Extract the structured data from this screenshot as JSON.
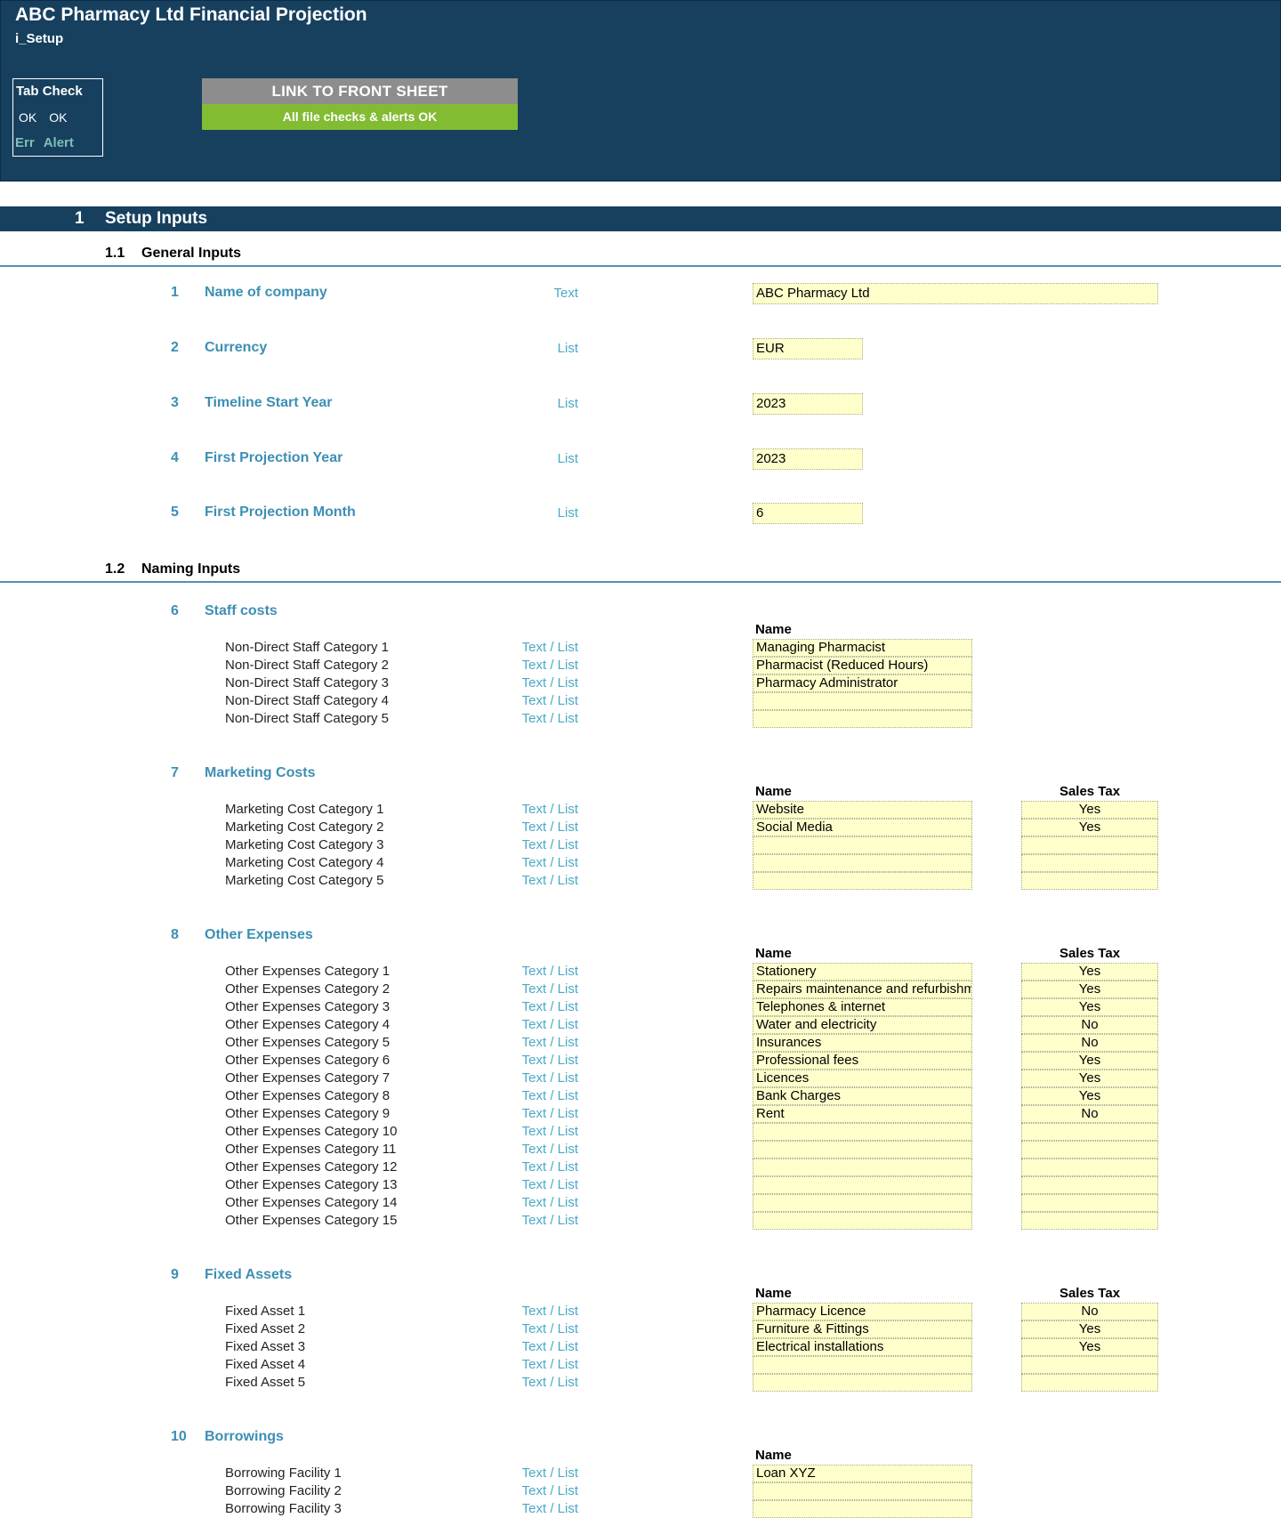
{
  "header": {
    "title": "ABC Pharmacy Ltd Financial Projection",
    "sheet_name": "i_Setup",
    "tab_check": {
      "title": "Tab Check",
      "row1": [
        "OK",
        "OK"
      ],
      "row2": [
        "Err",
        "Alert"
      ]
    },
    "link_button": "LINK TO FRONT SHEET",
    "check_status": "All file checks & alerts OK"
  },
  "section": {
    "number": "1",
    "title": "Setup Inputs"
  },
  "general": {
    "number": "1.1",
    "title": "General Inputs",
    "items": [
      {
        "num": "1",
        "label": "Name of company",
        "type": "Text",
        "value": "ABC Pharmacy Ltd"
      },
      {
        "num": "2",
        "label": "Currency",
        "type": "List",
        "value": "EUR"
      },
      {
        "num": "3",
        "label": "Timeline Start Year",
        "type": "List",
        "value": "2023"
      },
      {
        "num": "4",
        "label": "First Projection Year",
        "type": "List",
        "value": "2023"
      },
      {
        "num": "5",
        "label": "First Projection Month",
        "type": "List",
        "value": "6"
      }
    ]
  },
  "naming": {
    "number": "1.2",
    "title": "Naming Inputs",
    "col_name": "Name",
    "col_tax": "Sales Tax",
    "row_type": "Text / List",
    "groups": [
      {
        "num": "6",
        "title": "Staff costs",
        "has_tax": false,
        "rows": [
          {
            "label": "Non-Direct Staff Category 1",
            "name": "Managing Pharmacist"
          },
          {
            "label": "Non-Direct Staff Category 2",
            "name": "Pharmacist (Reduced Hours)"
          },
          {
            "label": "Non-Direct Staff Category 3",
            "name": "Pharmacy Administrator"
          },
          {
            "label": "Non-Direct Staff Category 4",
            "name": ""
          },
          {
            "label": "Non-Direct Staff Category 5",
            "name": ""
          }
        ]
      },
      {
        "num": "7",
        "title": "Marketing Costs",
        "has_tax": true,
        "rows": [
          {
            "label": "Marketing Cost Category 1",
            "name": "Website",
            "tax": "Yes"
          },
          {
            "label": "Marketing Cost Category 2",
            "name": "Social Media",
            "tax": "Yes"
          },
          {
            "label": "Marketing Cost Category 3",
            "name": "",
            "tax": ""
          },
          {
            "label": "Marketing Cost Category 4",
            "name": "",
            "tax": ""
          },
          {
            "label": "Marketing Cost Category 5",
            "name": "",
            "tax": ""
          }
        ]
      },
      {
        "num": "8",
        "title": "Other Expenses",
        "has_tax": true,
        "rows": [
          {
            "label": "Other Expenses Category 1",
            "name": "Stationery",
            "tax": "Yes"
          },
          {
            "label": "Other Expenses Category 2",
            "name": "Repairs maintenance and refurbishme",
            "tax": "Yes"
          },
          {
            "label": "Other Expenses Category 3",
            "name": "Telephones & internet",
            "tax": "Yes"
          },
          {
            "label": "Other Expenses Category 4",
            "name": "Water and electricity",
            "tax": "No"
          },
          {
            "label": "Other Expenses Category 5",
            "name": "Insurances",
            "tax": "No"
          },
          {
            "label": "Other Expenses Category 6",
            "name": "Professional fees",
            "tax": "Yes"
          },
          {
            "label": "Other Expenses Category 7",
            "name": "Licences",
            "tax": "Yes"
          },
          {
            "label": "Other Expenses Category 8",
            "name": "Bank Charges",
            "tax": "Yes"
          },
          {
            "label": "Other Expenses Category 9",
            "name": "Rent",
            "tax": "No"
          },
          {
            "label": "Other Expenses Category 10",
            "name": "",
            "tax": ""
          },
          {
            "label": "Other Expenses Category 11",
            "name": "",
            "tax": ""
          },
          {
            "label": "Other Expenses Category 12",
            "name": "",
            "tax": ""
          },
          {
            "label": "Other Expenses Category 13",
            "name": "",
            "tax": ""
          },
          {
            "label": "Other Expenses Category 14",
            "name": "",
            "tax": ""
          },
          {
            "label": "Other Expenses Category 15",
            "name": "",
            "tax": ""
          }
        ]
      },
      {
        "num": "9",
        "title": "Fixed Assets",
        "has_tax": true,
        "rows": [
          {
            "label": "Fixed Asset 1",
            "name": "Pharmacy Licence",
            "tax": "No"
          },
          {
            "label": "Fixed Asset 2",
            "name": "Furniture & Fittings",
            "tax": "Yes"
          },
          {
            "label": "Fixed Asset 3",
            "name": "Electrical installations",
            "tax": "Yes"
          },
          {
            "label": "Fixed Asset 4",
            "name": "",
            "tax": ""
          },
          {
            "label": "Fixed Asset 5",
            "name": "",
            "tax": ""
          }
        ]
      },
      {
        "num": "10",
        "title": "Borrowings",
        "has_tax": false,
        "rows": [
          {
            "label": "Borrowing Facility 1",
            "name": "Loan XYZ"
          },
          {
            "label": "Borrowing Facility 2",
            "name": ""
          },
          {
            "label": "Borrowing Facility 3",
            "name": ""
          }
        ]
      }
    ]
  },
  "colors": {
    "header_bg": "#17405f",
    "accent_blue": "#3d8fb3",
    "input_fill": "#ffffcc",
    "ok_green": "#82bc32",
    "button_grey": "#8d8d8d"
  }
}
